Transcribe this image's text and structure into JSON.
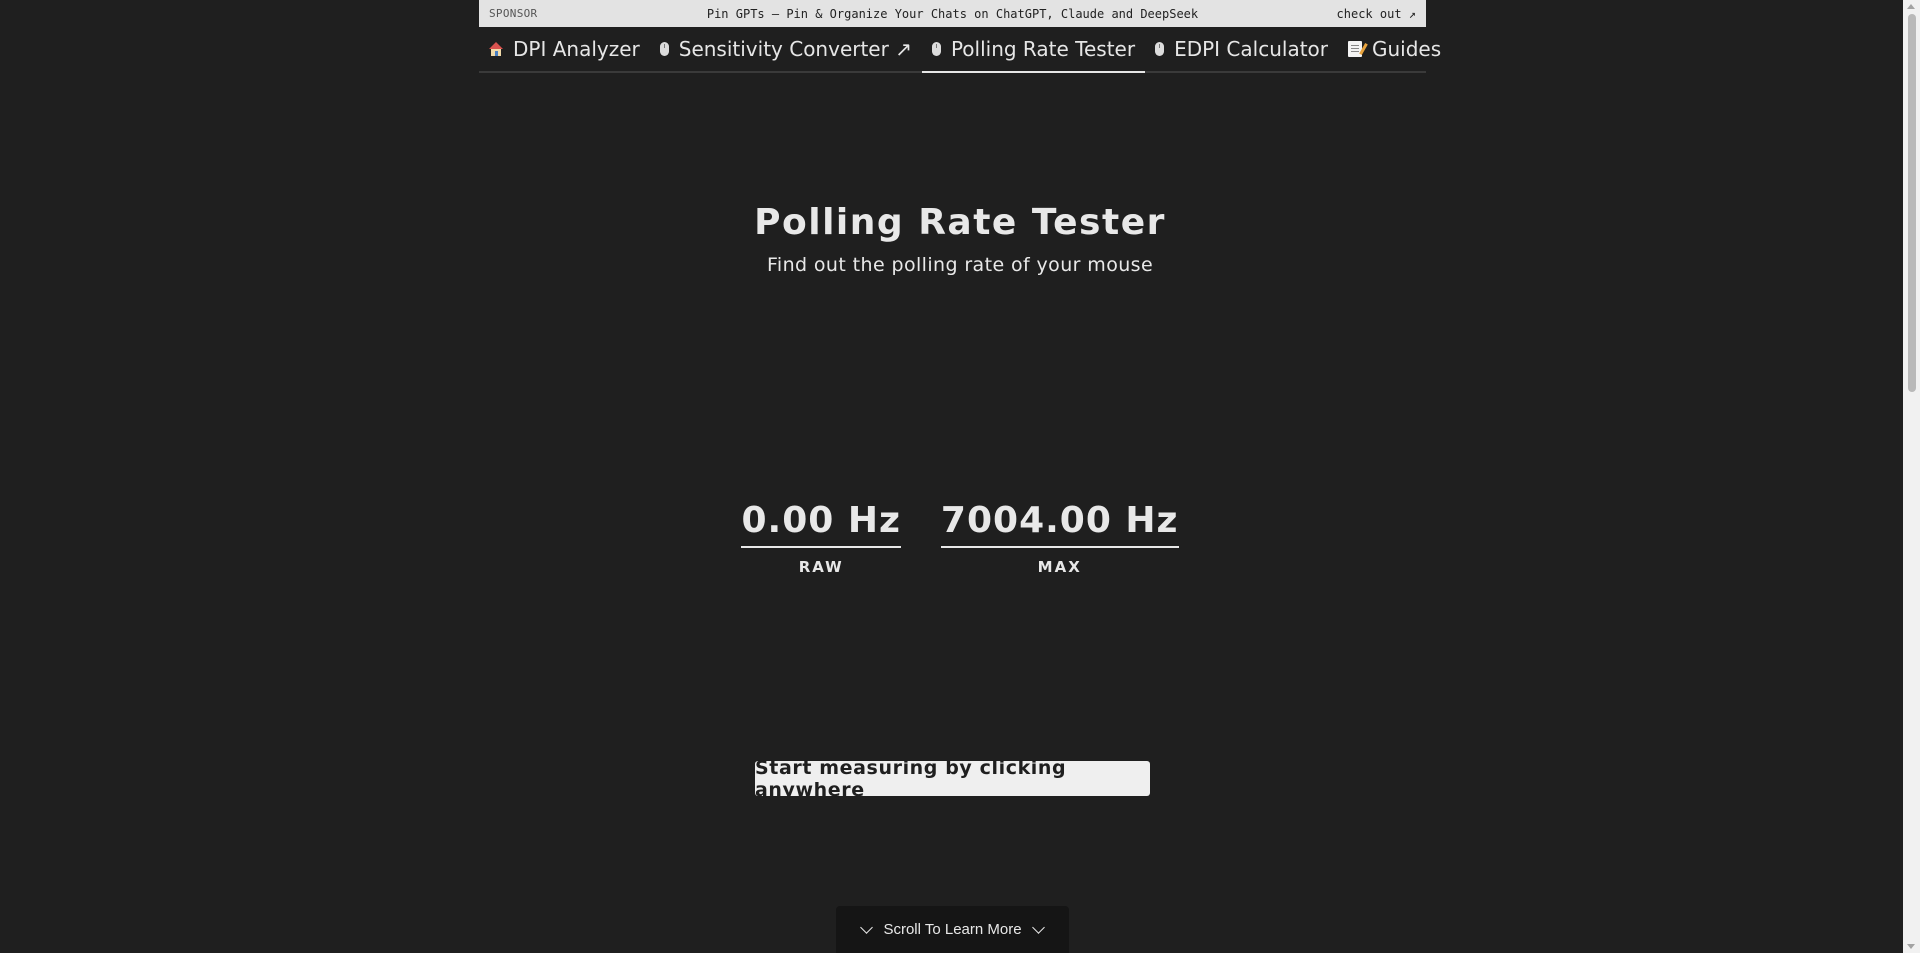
{
  "sponsor": {
    "label": "SPONSOR",
    "text": "Pin GPTs – Pin & Organize Your Chats on ChatGPT, Claude and DeepSeek",
    "cta": "check out ↗"
  },
  "nav": {
    "items": [
      {
        "label": "DPI Analyzer",
        "icon": "house-icon"
      },
      {
        "label": "Sensitivity Converter ↗",
        "icon": "mouse-icon"
      },
      {
        "label": "Polling Rate Tester",
        "icon": "mouse-icon",
        "active": true
      },
      {
        "label": "EDPI Calculator",
        "icon": "mouse-icon"
      },
      {
        "label": "Guides",
        "icon": "memo-icon"
      }
    ]
  },
  "main": {
    "title": "Polling Rate Tester",
    "subtitle": "Find out the polling rate of your mouse",
    "readouts": {
      "raw": {
        "value": "0.00 Hz",
        "label": "RAW"
      },
      "max": {
        "value": "7004.00 Hz",
        "label": "MAX"
      }
    },
    "start_label": "Start measuring by clicking anywhere",
    "scroll_hint": "Scroll To Learn More"
  },
  "colors": {
    "background": "#1f1f1f",
    "text": "#e8e8e8",
    "sponsor_bg": "#e3e3e3",
    "button_bg": "#efefef"
  }
}
